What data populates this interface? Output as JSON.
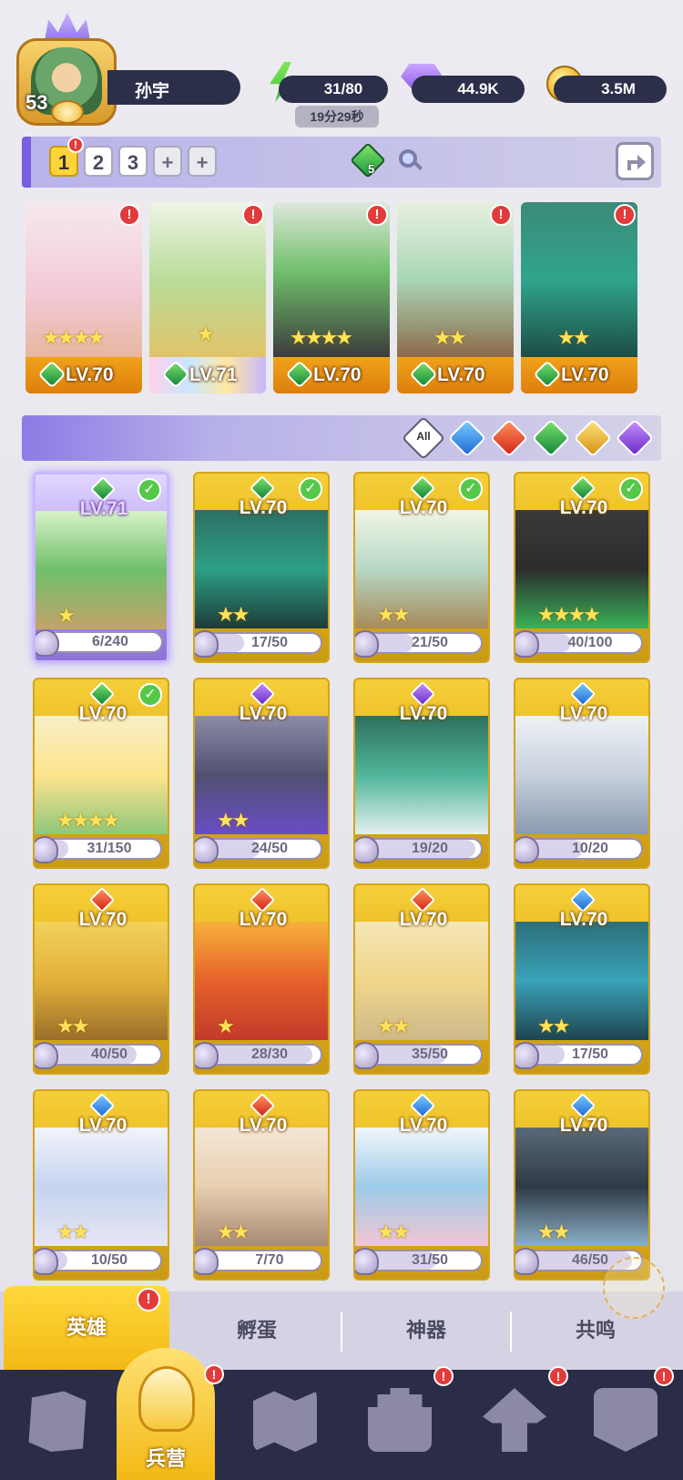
{
  "profile": {
    "level": "53",
    "name": "孙宇"
  },
  "resources": {
    "energy": "31/80",
    "energy_timer": "19分29秒",
    "gems": "44.9K",
    "gold": "3.5M"
  },
  "team_bar": {
    "tabs": [
      "1",
      "2",
      "3",
      "+",
      "+"
    ],
    "active_tab": "1",
    "green_element_count": "5"
  },
  "team_slots": [
    {
      "level": "LV.70",
      "stars": "★★★★",
      "element_icon": "nature-element-icon",
      "alert": "!"
    },
    {
      "level": "LV.71",
      "stars": "★",
      "element_icon": "nature-element-icon",
      "alert": "!"
    },
    {
      "level": "LV.70",
      "stars": "★★★★",
      "element_icon": "nature-element-icon",
      "alert": "!"
    },
    {
      "level": "LV.70",
      "stars": "★★",
      "element_icon": "nature-element-icon",
      "alert": "!"
    },
    {
      "level": "LV.70",
      "stars": "★★",
      "element_icon": "nature-element-icon",
      "alert": "!"
    }
  ],
  "filters": {
    "all_label": "All",
    "elements": [
      "water",
      "fire",
      "nature",
      "light",
      "dark"
    ]
  },
  "heroes": [
    {
      "level": "LV.71",
      "element": "nature",
      "shards": "6/240",
      "progress": 0.025,
      "stars": "★",
      "equipped": true,
      "selected": true
    },
    {
      "level": "LV.70",
      "element": "nature",
      "shards": "17/50",
      "progress": 0.34,
      "stars": "★★",
      "equipped": true,
      "selected": false
    },
    {
      "level": "LV.70",
      "element": "nature",
      "shards": "21/50",
      "progress": 0.42,
      "stars": "★★",
      "equipped": true,
      "selected": false
    },
    {
      "level": "LV.70",
      "element": "nature",
      "shards": "40/100",
      "progress": 0.4,
      "stars": "★★★★",
      "equipped": true,
      "selected": false
    },
    {
      "level": "LV.70",
      "element": "nature",
      "shards": "31/150",
      "progress": 0.21,
      "stars": "★★★★",
      "equipped": true,
      "selected": false
    },
    {
      "level": "LV.70",
      "element": "dark",
      "shards": "24/50",
      "progress": 0.48,
      "stars": "★★",
      "equipped": false,
      "selected": false
    },
    {
      "level": "LV.70",
      "element": "dark",
      "shards": "19/20",
      "progress": 0.95,
      "stars": "",
      "equipped": false,
      "selected": false
    },
    {
      "level": "LV.70",
      "element": "water",
      "shards": "10/20",
      "progress": 0.5,
      "stars": "",
      "equipped": false,
      "selected": false
    },
    {
      "level": "LV.70",
      "element": "fire",
      "shards": "40/50",
      "progress": 0.8,
      "stars": "★★",
      "equipped": false,
      "selected": false
    },
    {
      "level": "LV.70",
      "element": "fire",
      "shards": "28/30",
      "progress": 0.93,
      "stars": "★",
      "equipped": false,
      "selected": false
    },
    {
      "level": "LV.70",
      "element": "fire",
      "shards": "35/50",
      "progress": 0.7,
      "stars": "★★",
      "equipped": false,
      "selected": false
    },
    {
      "level": "LV.70",
      "element": "water",
      "shards": "17/50",
      "progress": 0.34,
      "stars": "★★",
      "equipped": false,
      "selected": false
    },
    {
      "level": "LV.70",
      "element": "water",
      "shards": "10/50",
      "progress": 0.2,
      "stars": "★★",
      "equipped": false,
      "selected": false
    },
    {
      "level": "LV.70",
      "element": "fire",
      "shards": "7/70",
      "progress": 0.1,
      "stars": "★★",
      "equipped": false,
      "selected": false
    },
    {
      "level": "LV.70",
      "element": "water",
      "shards": "31/50",
      "progress": 0.62,
      "stars": "★★",
      "equipped": false,
      "selected": false
    },
    {
      "level": "LV.70",
      "element": "water",
      "shards": "46/50",
      "progress": 0.92,
      "stars": "★★",
      "equipped": false,
      "selected": false
    }
  ],
  "sub_tabs": [
    "英雄",
    "孵蛋",
    "神器",
    "共鸣"
  ],
  "sub_tab_alert": "!",
  "nav": {
    "active_label": "兵营",
    "items": [
      "cards-icon",
      "barracks-icon",
      "map-icon",
      "castle-icon",
      "mushroom-icon",
      "guild-banner-icon"
    ],
    "alert": "!"
  },
  "colors": {
    "accent_gold": "#f2b914",
    "nav_bg": "#2b2c47",
    "nature": "#13863a",
    "water": "#1f6bd6",
    "fire": "#d3261b",
    "light": "#d39312",
    "dark": "#6a2ec5"
  }
}
